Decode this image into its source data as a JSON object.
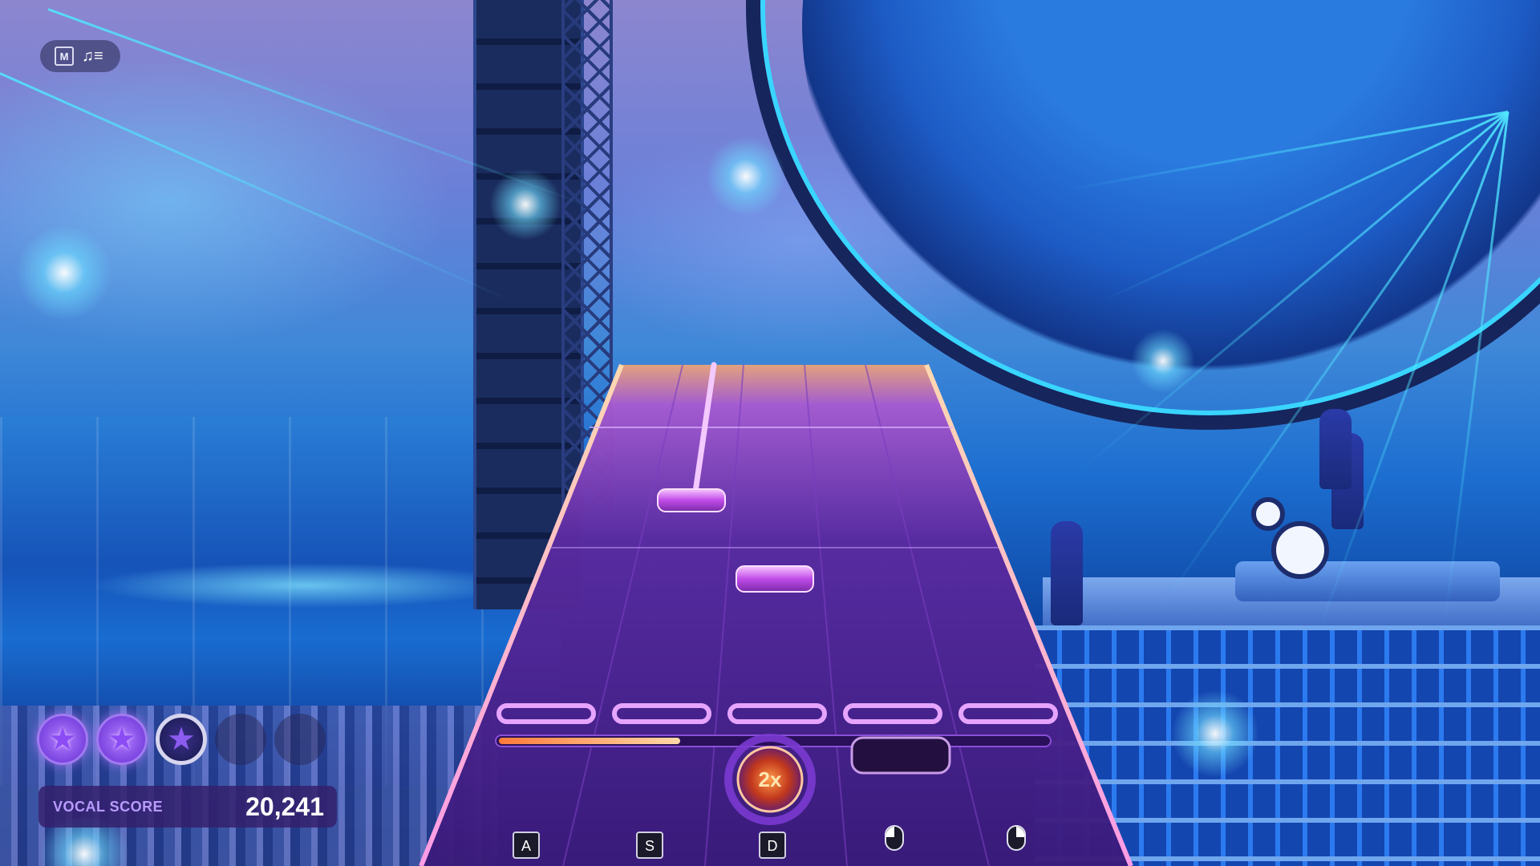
{
  "hud": {
    "mode_key": "M",
    "music_icon": "music-queue-icon",
    "score_label": "VOCAL SCORE",
    "score_value": "20,241",
    "stars": [
      {
        "state": "filled"
      },
      {
        "state": "filled"
      },
      {
        "state": "in-progress"
      },
      {
        "state": "empty"
      },
      {
        "state": "empty"
      }
    ]
  },
  "highway": {
    "multiplier": "2x",
    "lanes": [
      {
        "key": "A",
        "icon": null
      },
      {
        "key": "S",
        "icon": null
      },
      {
        "key": "D",
        "icon": null
      },
      {
        "key": null,
        "icon": "mouse-left-icon"
      },
      {
        "key": null,
        "icon": "mouse-right-icon"
      }
    ],
    "overdrive_progress": 0.33,
    "colors": {
      "lane": "#4a1f8a",
      "note": "#d45cf0",
      "strike_line": "#d98bff",
      "accent": "#ff9a4a"
    }
  }
}
